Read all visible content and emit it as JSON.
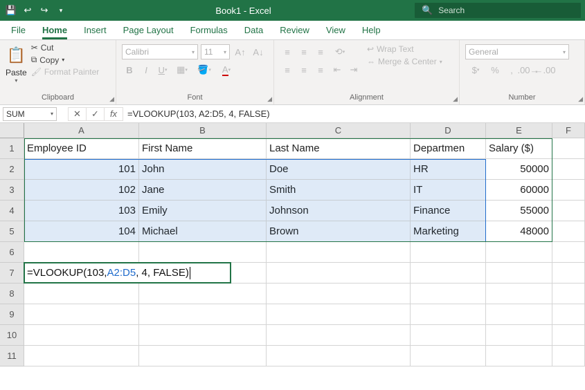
{
  "titlebar": {
    "doc_title": "Book1 - Excel",
    "search_placeholder": "Search"
  },
  "tabs": [
    "File",
    "Home",
    "Insert",
    "Page Layout",
    "Formulas",
    "Data",
    "Review",
    "View",
    "Help"
  ],
  "active_tab": "Home",
  "ribbon": {
    "clipboard": {
      "label": "Clipboard",
      "paste": "Paste",
      "cut": "Cut",
      "copy": "Copy",
      "format_painter": "Format Painter"
    },
    "font": {
      "label": "Font",
      "name": "Calibri",
      "size": "11"
    },
    "alignment": {
      "label": "Alignment",
      "wrap": "Wrap Text",
      "merge": "Merge & Center"
    },
    "number": {
      "label": "Number",
      "format": "General"
    }
  },
  "formula_bar": {
    "namebox": "SUM",
    "formula": "=VLOOKUP(103, A2:D5, 4, FALSE)"
  },
  "columns": [
    "A",
    "B",
    "C",
    "D",
    "E",
    "F"
  ],
  "rows": [
    "1",
    "2",
    "3",
    "4",
    "5",
    "6",
    "7",
    "8",
    "9",
    "10",
    "11"
  ],
  "headers": {
    "A": "Employee ID",
    "B": "First Name",
    "C": "Last Name",
    "D": "Departmen",
    "E": "Salary ($)"
  },
  "data_rows": [
    {
      "id": "101",
      "first": "John",
      "last": "Doe",
      "dept": "HR",
      "sal": "50000"
    },
    {
      "id": "102",
      "first": "Jane",
      "last": "Smith",
      "dept": "IT",
      "sal": "60000"
    },
    {
      "id": "103",
      "first": "Emily",
      "last": "Johnson",
      "dept": "Finance",
      "sal": "55000"
    },
    {
      "id": "104",
      "first": "Michael",
      "last": "Brown",
      "dept": "Marketing",
      "sal": "48000"
    }
  ],
  "edit_cell": {
    "pre": "=VLOOKUP(103, ",
    "range": "A2:D5",
    "post": ", 4, FALSE)"
  }
}
